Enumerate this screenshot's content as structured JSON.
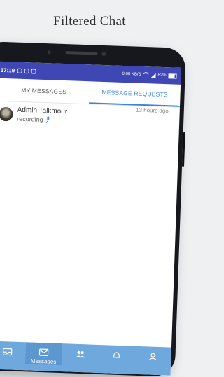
{
  "headline": "Filtered Chat",
  "statusbar": {
    "time": "17:19",
    "speed": "0.00 KB/S",
    "battery": "82%"
  },
  "tabs": [
    {
      "label": "MY MESSAGES",
      "active": false
    },
    {
      "label": "MESSAGE REQUESTS",
      "active": true
    }
  ],
  "chats": [
    {
      "name": "Admin Talkmour",
      "status": "recording",
      "time": "13 hours ago"
    }
  ],
  "bottom_nav": {
    "items": [
      {
        "icon": "inbox-icon",
        "label": ""
      },
      {
        "icon": "messages-icon",
        "label": "Messages",
        "active": true
      },
      {
        "icon": "group-icon",
        "label": ""
      },
      {
        "icon": "notifications-icon",
        "label": ""
      },
      {
        "icon": "profile-icon",
        "label": ""
      }
    ]
  },
  "colors": {
    "statusbar": "#3f47b5",
    "accent": "#3a86d8",
    "bottom_nav": "#6fa8dc"
  }
}
